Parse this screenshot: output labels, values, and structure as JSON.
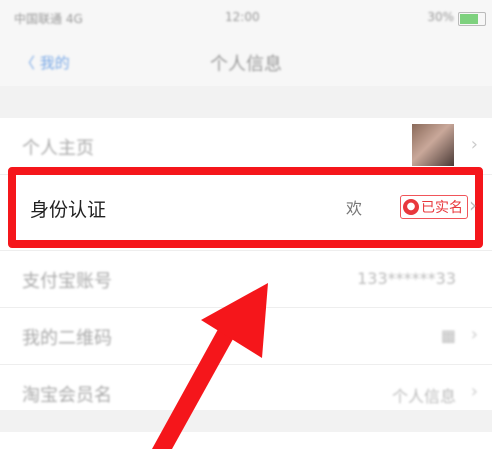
{
  "status_bar": {
    "carrier": "中国联通 4G",
    "time": "12:00",
    "battery": "30%"
  },
  "nav": {
    "back_label": "〈 我的",
    "title": "个人信息"
  },
  "rows": [
    {
      "label": "个人主页",
      "value": "",
      "chevron": "›"
    },
    {
      "label": "身份认证",
      "value": "欢",
      "badge": "已实名",
      "chevron": "›"
    },
    {
      "label": "支付宝账号",
      "value": "133******33"
    },
    {
      "label": "我的二维码",
      "value": "▦",
      "chevron": "›"
    },
    {
      "label": "淘宝会员名",
      "value": "个人信息",
      "chevron": "›"
    }
  ],
  "colors": {
    "highlight": "#f5161b",
    "badge": "#e8383d",
    "accent": "#7aa9e6"
  }
}
